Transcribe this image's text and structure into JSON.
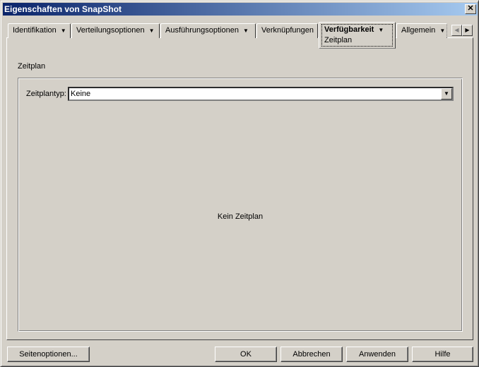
{
  "window": {
    "title": "Eigenschaften von SnapShot",
    "close": "✕"
  },
  "tabs": [
    {
      "label": "Identifikation",
      "dropdown": true
    },
    {
      "label": "Verteilungsoptionen",
      "dropdown": true
    },
    {
      "label": "Ausführungsoptionen",
      "dropdown": true
    },
    {
      "label": "Verknüpfungen",
      "dropdown": false
    },
    {
      "label": "Verfügbarkeit",
      "dropdown": true,
      "active": true,
      "subtab": "Zeitplan"
    },
    {
      "label": "Allgemein",
      "dropdown": true
    }
  ],
  "tab_scroll": {
    "left": "◀",
    "right": "▶"
  },
  "section_title": "Zeitplan",
  "schedule": {
    "type_label": "Zeitplantyp:",
    "type_value": "Keine",
    "empty_text": "Kein Zeitplan"
  },
  "buttons": {
    "page_options": "Seitenoptionen...",
    "ok": "OK",
    "cancel": "Abbrechen",
    "apply": "Anwenden",
    "help": "Hilfe"
  }
}
